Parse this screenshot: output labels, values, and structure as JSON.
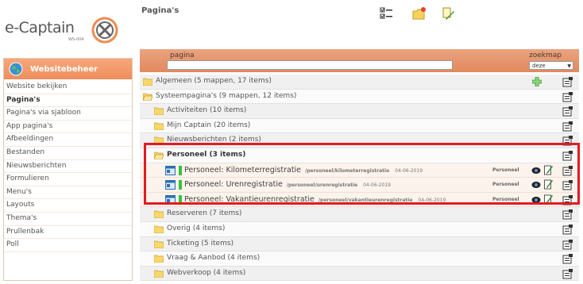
{
  "logo": {
    "name": "e-Captain",
    "version": "WS-004"
  },
  "sidebar": {
    "title": "Websitebeheer",
    "items": [
      {
        "label": "Website bekijken",
        "active": false
      },
      {
        "label": "Pagina's",
        "active": true
      },
      {
        "label": "Pagina's via sjabloon",
        "active": false
      },
      {
        "label": "App pagina's",
        "active": false
      },
      {
        "label": "Afbeeldingen",
        "active": false
      },
      {
        "label": "Bestanden",
        "active": false
      },
      {
        "label": "Nieuwsberichten",
        "active": false
      },
      {
        "label": "Formulieren",
        "active": false
      },
      {
        "label": "Menu's",
        "active": false
      },
      {
        "label": "Layouts",
        "active": false
      },
      {
        "label": "Thema's",
        "active": false
      },
      {
        "label": "Prullenbak",
        "active": false
      },
      {
        "label": "Poll",
        "active": false
      }
    ]
  },
  "header": {
    "title": "Pagina's",
    "toolbar_icons": [
      "checklist-icon",
      "new-folder-icon",
      "new-page-icon"
    ]
  },
  "table": {
    "col_pagina": "pagina",
    "pagina_value": "",
    "col_zoekmap": "zoekmap",
    "zoekmap_value": "deze",
    "rows": [
      {
        "label": "Algemeen (5 mappen, 17 items)"
      },
      {
        "label": "Systeempagina's (9 mappen, 12 items)"
      },
      {
        "label": "Activiteiten (10 items)"
      },
      {
        "label": "Mijn Captain (20 items)"
      },
      {
        "label": "Nieuwsberichten (2 items)"
      },
      {
        "label": "Personeel (3 items)"
      },
      {
        "label": "Reserveren (7 items)"
      },
      {
        "label": "Overig (4 items)"
      },
      {
        "label": "Ticketing (5 items)"
      },
      {
        "label": "Vraag & Aanbod (4 items)"
      },
      {
        "label": "Webverkoop (4 items)"
      }
    ],
    "pages": [
      {
        "title": "Personeel: Kilometerregistratie",
        "path": "/personeel/kilometerregistratie",
        "date": "04-06-2019",
        "category": "Personeel"
      },
      {
        "title": "Personeel: Urenregistratie",
        "path": "/personeel/urenregistratie",
        "date": "04-06-2019",
        "category": "Personeel"
      },
      {
        "title": "Personeel: Vakantieurenregistratie",
        "path": "/personeel/vakantieurenregistratie",
        "date": "04-06-2019",
        "category": "Personeel"
      }
    ]
  },
  "colors": {
    "accent": "#ee8e5d",
    "highlight": "#e11b22",
    "status_green": "#33c33a"
  }
}
